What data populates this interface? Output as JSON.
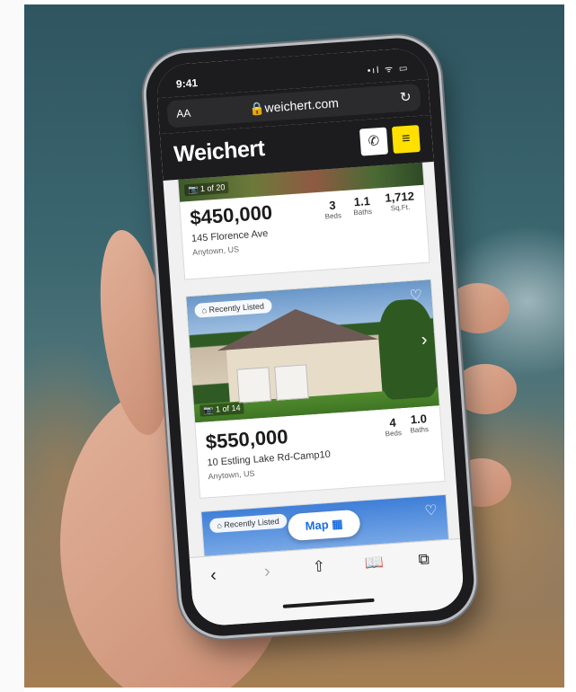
{
  "status": {
    "time": "9:41",
    "icons": "•ıl ᯤ ▭"
  },
  "browser": {
    "text_size": "AA",
    "url": "weichert.com",
    "reload_icon": "reload-icon"
  },
  "site": {
    "logo": "Weichert",
    "phone_icon": "phone-icon",
    "menu_icon": "menu-icon",
    "accent": "#ffe000"
  },
  "listings": [
    {
      "photo_count": "1 of 20",
      "price": "$450,000",
      "address": "145 Florence Ave",
      "city": "Anytown, US",
      "beds": "3",
      "beds_label": "Beds",
      "baths": "1.1",
      "baths_label": "Baths",
      "sqft": "1,712",
      "sqft_label": "Sq.Ft."
    },
    {
      "badge": "Recently Listed",
      "photo_count": "1 of 14",
      "price": "$550,000",
      "address": "10 Estling Lake Rd-Camp10",
      "city": "Anytown, US",
      "beds": "4",
      "beds_label": "Beds",
      "baths": "1.0",
      "baths_label": "Baths"
    },
    {
      "badge": "Recently Listed"
    }
  ],
  "map_button": "Map",
  "toolbar": {
    "back": "back-icon",
    "forward": "forward-icon",
    "share": "share-icon",
    "bookmarks": "bookmarks-icon",
    "tabs": "tabs-icon"
  }
}
